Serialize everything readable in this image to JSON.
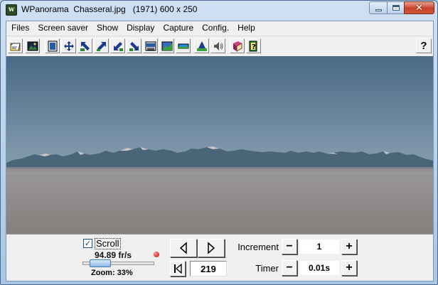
{
  "window": {
    "title": "WPanorama  Chasseral.jpg   (1971) 600 x 250",
    "close_glyph": "✕"
  },
  "menu": [
    "Files",
    "Screen saver",
    "Show",
    "Display",
    "Capture",
    "Config.",
    "Help"
  ],
  "toolbar": {
    "icons": [
      "open-folder-icon",
      "picture-icon",
      "fit-window-icon",
      "move-icon",
      "arrow-up-left-icon",
      "arrow-up-right-icon",
      "arrow-down-left-icon",
      "arrow-down-right-icon",
      "scroll-bar-icon",
      "panorama-icon",
      "strip-icon",
      "pyramid-icon",
      "speaker-icon",
      "book-icon",
      "help-book-icon"
    ],
    "help_label": "?"
  },
  "controls": {
    "scroll_checked": true,
    "scroll_check_glyph": "✓",
    "scroll_label": "Scroll",
    "fps": "94.89 fr/s",
    "zoom": "Zoom: 33%",
    "zoom_fraction": 0.33,
    "position": "219",
    "increment_label": "Increment",
    "increment_value": "1",
    "timer_label": "Timer",
    "timer_value": "0.01s",
    "minus": "−",
    "plus": "+"
  },
  "colors": {
    "sky_top": "#4a6a86",
    "sky_bottom": "#95abbb",
    "fog": "#8e8a88",
    "mountains": "#4a6478"
  }
}
